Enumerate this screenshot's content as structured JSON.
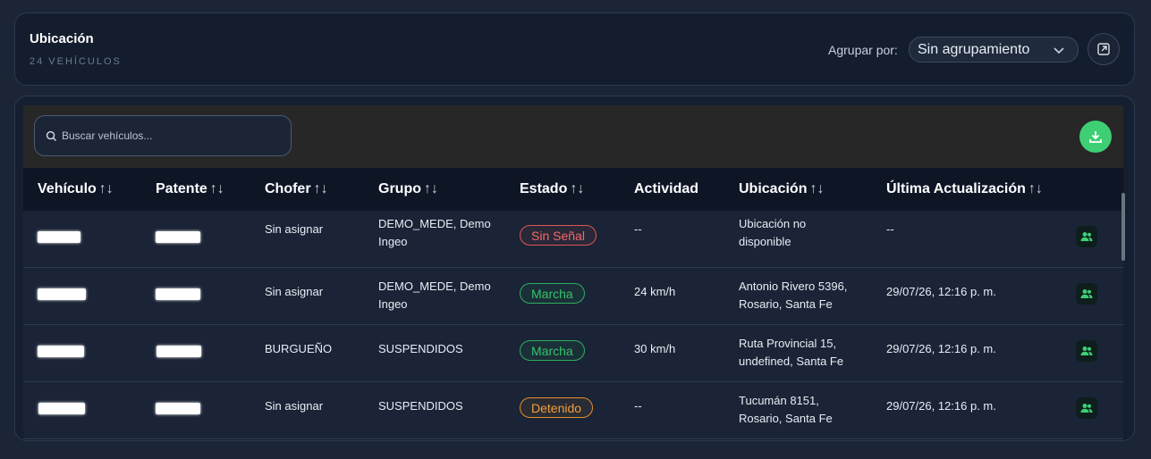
{
  "header": {
    "title": "Ubicación",
    "subtitle": "24 VEHÍCULOS",
    "group_by_label": "Agrupar por:",
    "group_by_value": "Sin agrupamiento"
  },
  "search": {
    "placeholder": "Buscar vehículos..."
  },
  "colors": {
    "accent_green": "#3ecf74",
    "status_sin_senal": "#e05555",
    "status_marcha": "#2fae5f",
    "status_detenido": "#e28e2a"
  },
  "table": {
    "columns": [
      "Vehículo",
      "Patente",
      "Chofer",
      "Grupo",
      "Estado",
      "Actividad",
      "Ubicación",
      "Última Actualización"
    ],
    "sort_glyph": "↑↓",
    "rows": [
      {
        "chofer": "Sin asignar",
        "grupo": [
          "DEMO_MEDE, Demo",
          "Ingeo"
        ],
        "estado": "Sin Señal",
        "estado_type": "sin",
        "actividad": "--",
        "ubicacion": [
          "Ubicación no",
          "disponible"
        ],
        "actualizacion": "--"
      },
      {
        "chofer": "Sin asignar",
        "grupo": [
          "DEMO_MEDE, Demo",
          "Ingeo"
        ],
        "estado": "Marcha",
        "estado_type": "marcha",
        "actividad": "24 km/h",
        "ubicacion": [
          "Antonio Rivero 5396,",
          "Rosario, Santa Fe"
        ],
        "actualizacion": "29/07/26, 12:16 p. m."
      },
      {
        "chofer": "BURGUEÑO",
        "grupo": [
          "SUSPENDIDOS",
          ""
        ],
        "estado": "Marcha",
        "estado_type": "marcha",
        "actividad": "30 km/h",
        "ubicacion": [
          "Ruta Provincial 15,",
          "undefined, Santa Fe"
        ],
        "actualizacion": "29/07/26, 12:16 p. m."
      },
      {
        "chofer": "Sin asignar",
        "grupo": [
          "SUSPENDIDOS",
          ""
        ],
        "estado": "Detenido",
        "estado_type": "detenido",
        "actividad": "--",
        "ubicacion": [
          "Tucumán 8151,",
          "Rosario, Santa Fe"
        ],
        "actualizacion": "29/07/26, 12:16 p. m."
      }
    ]
  }
}
